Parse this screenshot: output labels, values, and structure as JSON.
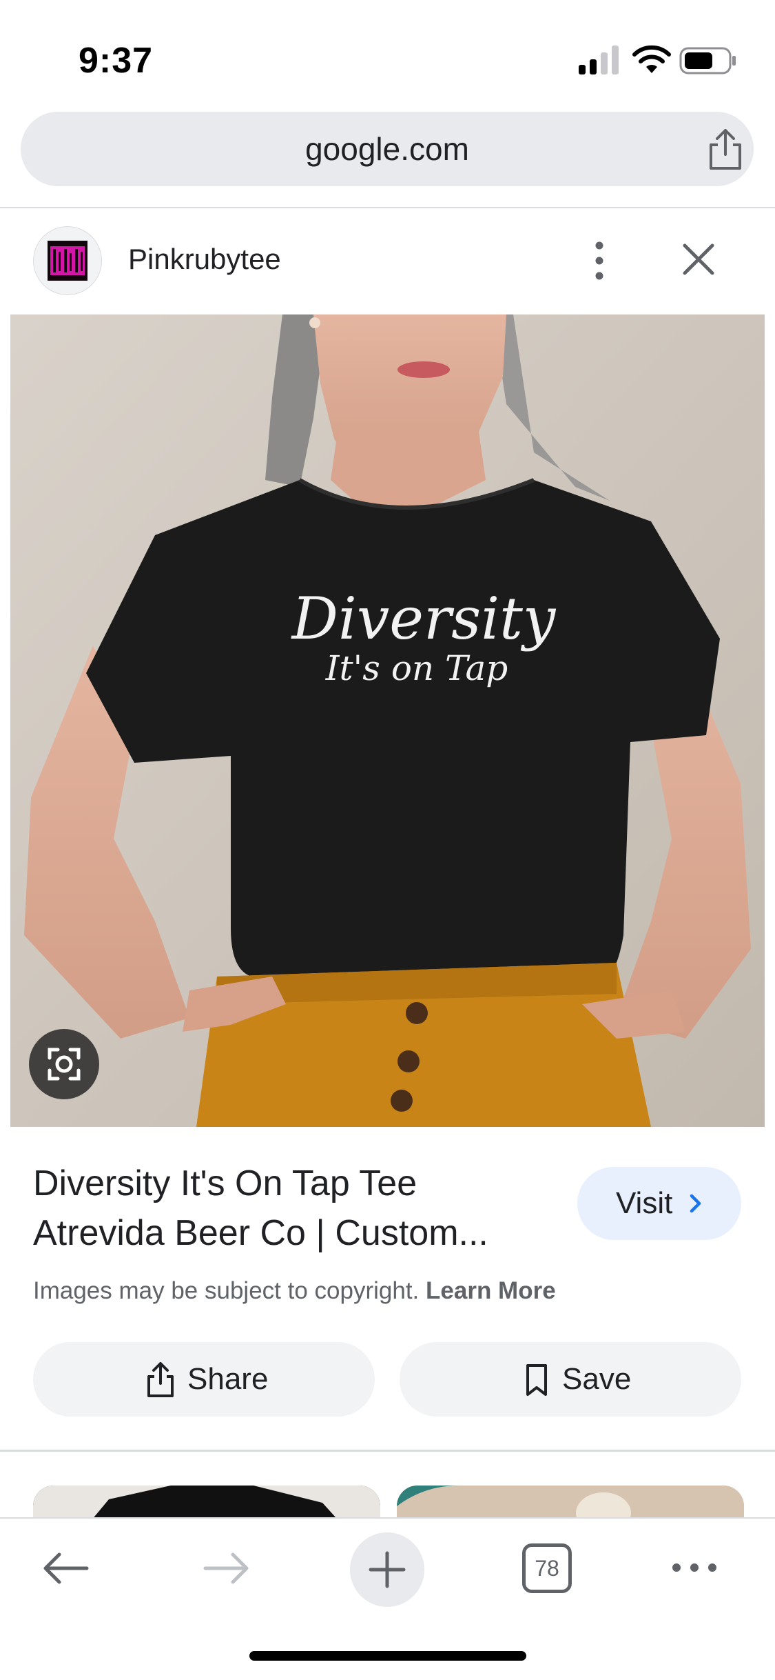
{
  "status_bar": {
    "time": "9:37"
  },
  "url_bar": {
    "url": "google.com"
  },
  "source": {
    "name": "Pinkrubytee"
  },
  "image": {
    "shirt_text_line1": "Diversity",
    "shirt_text_line2": "It's on Tap"
  },
  "result": {
    "title_line1": "Diversity It's On Tap Tee",
    "title_line2": "Atrevida Beer Co | Custom...",
    "visit_label": "Visit",
    "copyright_text": "Images may be subject to copyright.",
    "learn_more": "Learn More"
  },
  "actions": {
    "share_label": "Share",
    "save_label": "Save"
  },
  "toolbar": {
    "tab_count": "78"
  },
  "colors": {
    "accent": "#1a73e8",
    "visit_bg": "#e8f0fe",
    "pill_bg": "#f1f3f4",
    "shirt": "#1b1b1b",
    "pants": "#c98417"
  }
}
